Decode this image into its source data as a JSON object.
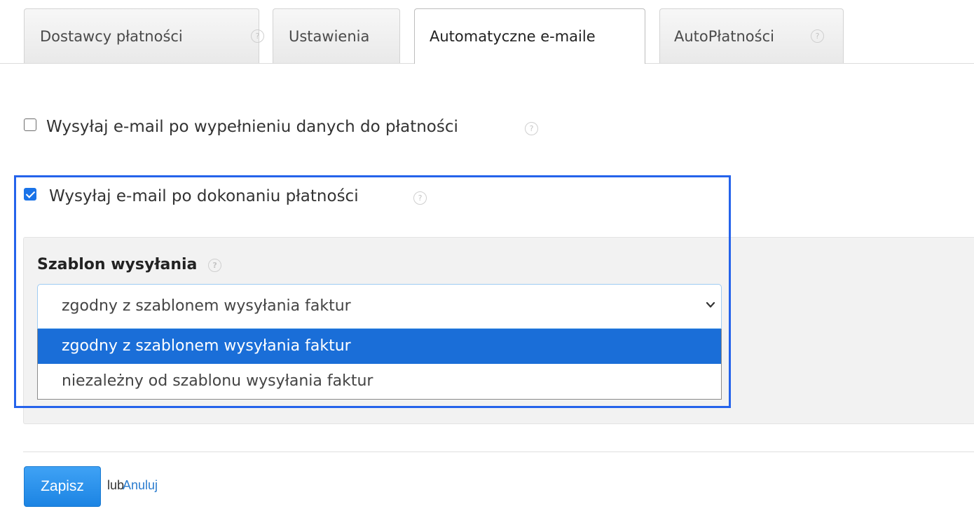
{
  "tabs": [
    {
      "label": "Dostawcy płatności",
      "has_help": true
    },
    {
      "label": "Ustawienia",
      "has_help": false
    },
    {
      "label": "Automatyczne e-maile",
      "has_help": false,
      "active": true
    },
    {
      "label": "AutoPłatności",
      "has_help": true
    }
  ],
  "help_icon_glyph": "?",
  "options_form": {
    "send_after_filling": {
      "label": "Wysyłaj e-mail po wypełnieniu danych do płatności",
      "checked": false
    },
    "send_after_payment": {
      "label": "Wysyłaj e-mail po dokonaniu płatności",
      "checked": true
    }
  },
  "template_section": {
    "title": "Szablon wysyłania",
    "selected_value": "zgodny z szablonem wysyłania faktur",
    "options": [
      {
        "label": "zgodny z szablonem wysyłania faktur",
        "selected": true
      },
      {
        "label": "niezależny od szablonu wysyłania faktur",
        "selected": false
      }
    ]
  },
  "actions": {
    "save_label": "Zapisz",
    "or_label": "lub",
    "cancel_label": "Anuluj"
  },
  "colors": {
    "accent": "#1a73e8",
    "selected_option_bg": "#1a6ed8",
    "highlight_frame": "#2563eb",
    "link": "#2a7ccf"
  }
}
